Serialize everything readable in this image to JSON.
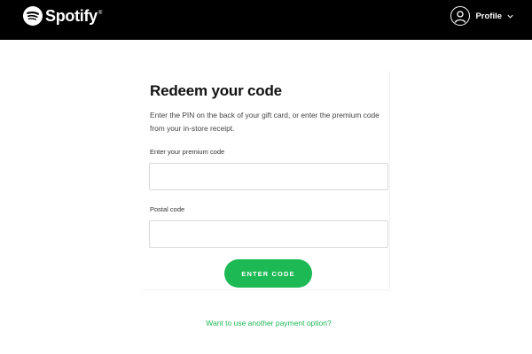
{
  "header": {
    "brand": "Spotify",
    "trademark": "®",
    "logo_icon": "spotify-logo-icon",
    "profile_label": "Profile",
    "avatar_icon": "user-avatar-icon",
    "dropdown_icon": "chevron-down-icon"
  },
  "form": {
    "title": "Redeem your code",
    "subtitle": "Enter the PIN on the back of your gift card, or enter the premium code from your in-store receipt.",
    "premium_code_label": "Enter your premium code",
    "premium_code_value": "",
    "postal_code_label": "Postal code",
    "postal_code_value": "",
    "submit_label": "ENTER CODE"
  },
  "footer": {
    "alt_payment_link": "Want to use another payment option?"
  },
  "colors": {
    "topbar": "#000000",
    "accent": "#1db954",
    "background": "#ffffff"
  }
}
